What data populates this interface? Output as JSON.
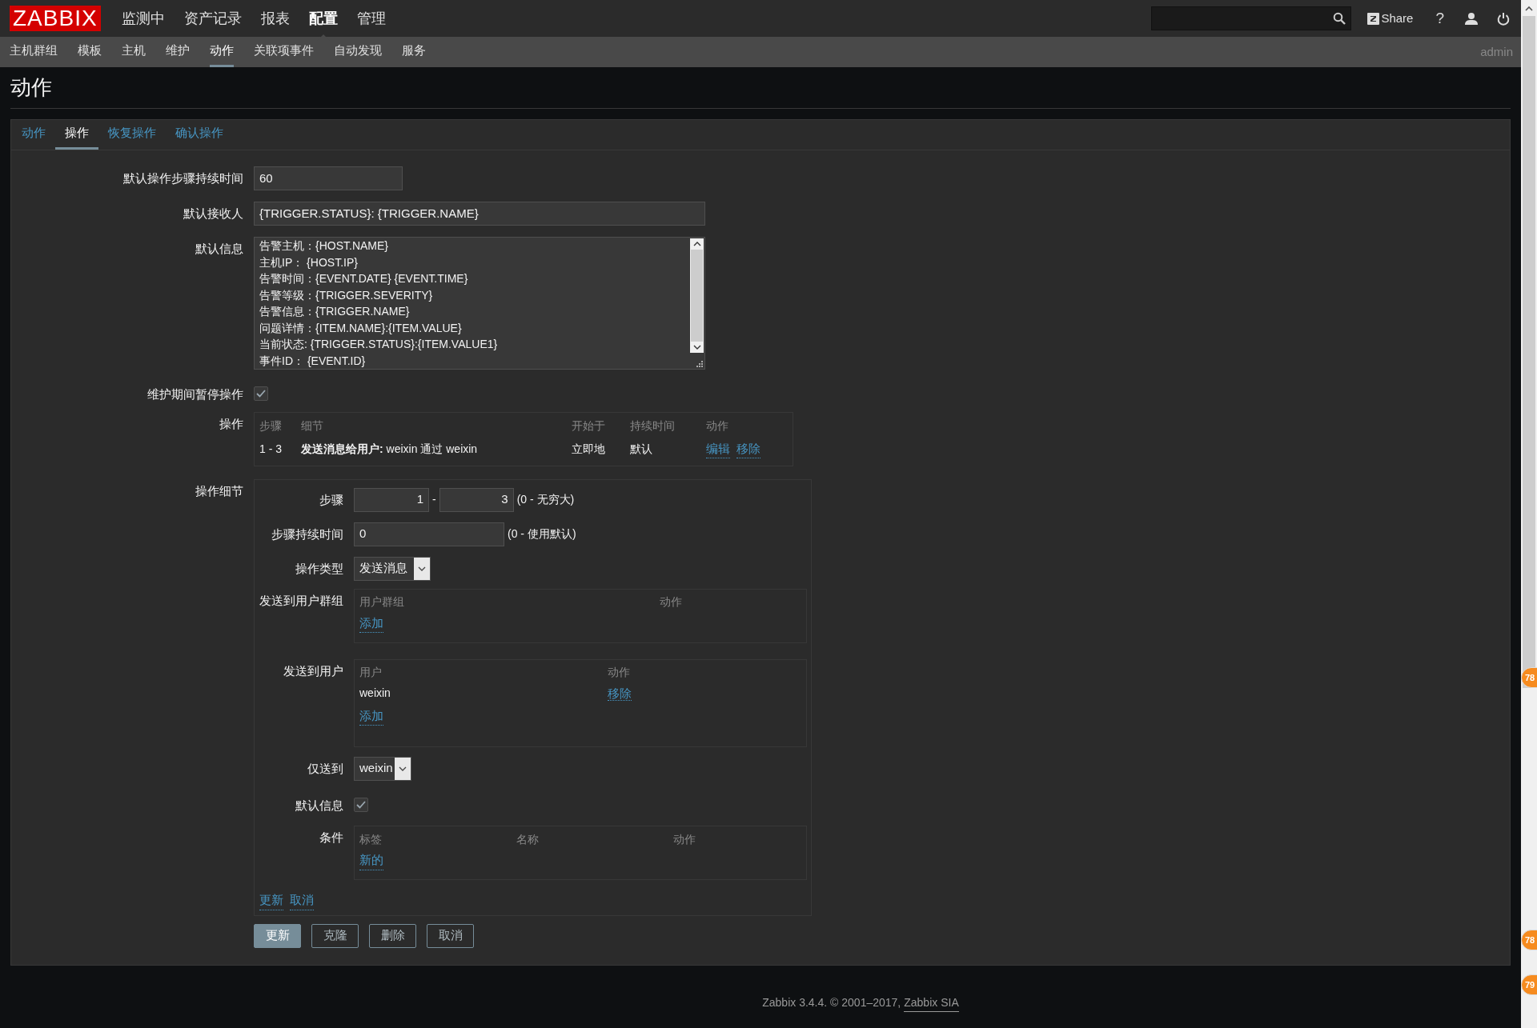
{
  "header": {
    "logo": "ZABBIX",
    "menu": [
      {
        "label": "监测中",
        "selected": false
      },
      {
        "label": "资产记录",
        "selected": false
      },
      {
        "label": "报表",
        "selected": false
      },
      {
        "label": "配置",
        "selected": true
      },
      {
        "label": "管理",
        "selected": false
      }
    ],
    "share": "Share",
    "help": "?"
  },
  "subnav": {
    "items": [
      {
        "label": "主机群组",
        "selected": false
      },
      {
        "label": "模板",
        "selected": false
      },
      {
        "label": "主机",
        "selected": false
      },
      {
        "label": "维护",
        "selected": false
      },
      {
        "label": "动作",
        "selected": true
      },
      {
        "label": "关联项事件",
        "selected": false
      },
      {
        "label": "自动发现",
        "selected": false
      },
      {
        "label": "服务",
        "selected": false
      }
    ],
    "user": "admin"
  },
  "page_title": "动作",
  "tabs": [
    {
      "label": "动作",
      "selected": false
    },
    {
      "label": "操作",
      "selected": true
    },
    {
      "label": "恢复操作",
      "selected": false
    },
    {
      "label": "确认操作",
      "selected": false
    }
  ],
  "form": {
    "default_step_duration": {
      "label": "默认操作步骤持续时间",
      "value": "60"
    },
    "default_subject": {
      "label": "默认接收人",
      "value": "{TRIGGER.STATUS}: {TRIGGER.NAME}"
    },
    "default_message": {
      "label": "默认信息",
      "lines": [
        "告警主机：{HOST.NAME}",
        "主机IP： {HOST.IP}",
        "告警时间：{EVENT.DATE} {EVENT.TIME}",
        "告警等级：{TRIGGER.SEVERITY}",
        "告警信息：{TRIGGER.NAME}",
        "问题详情：{ITEM.NAME}:{ITEM.VALUE}",
        "当前状态: {TRIGGER.STATUS}:{ITEM.VALUE1}",
        "事件ID： {EVENT.ID}"
      ]
    },
    "pause_in_maintenance": {
      "label": "维护期间暂停操作",
      "checked": true
    },
    "operations": {
      "label": "操作",
      "columns": [
        "步骤",
        "细节",
        "开始于",
        "持续时间",
        "动作"
      ],
      "rows": [
        {
          "steps": "1 - 3",
          "details": "**发送消息给用户:** weixin 通过 weixin",
          "start_in": "立即地",
          "duration": "默认",
          "actions": [
            "编辑",
            "移除"
          ]
        }
      ]
    },
    "operation_details": {
      "label": "操作细节",
      "steps": {
        "label": "步骤",
        "from": "1",
        "separator": "-",
        "to": "3",
        "hint": "(0 - 无穷大)"
      },
      "step_duration": {
        "label": "步骤持续时间",
        "value": "0",
        "hint": "(0 - 使用默认)"
      },
      "operation_type": {
        "label": "操作类型",
        "value": "发送消息"
      },
      "user_groups": {
        "label": "发送到用户群组",
        "columns": [
          "用户群组",
          "动作"
        ],
        "add_link": "添加"
      },
      "users": {
        "label": "发送到用户",
        "columns": [
          "用户",
          "动作"
        ],
        "rows": [
          {
            "user": "weixin",
            "action": "移除"
          }
        ],
        "add_link": "添加"
      },
      "send_only_to": {
        "label": "仅送到",
        "value": "weixin"
      },
      "default_message": {
        "label": "默认信息",
        "checked": true
      },
      "conditions": {
        "label": "条件",
        "columns": [
          "标签",
          "名称",
          "动作"
        ],
        "new_link": "新的"
      },
      "links": [
        "更新",
        "取消"
      ]
    },
    "buttons": [
      {
        "label": "更新",
        "kind": "primary"
      },
      {
        "label": "克隆",
        "kind": "secondary"
      },
      {
        "label": "删除",
        "kind": "secondary"
      },
      {
        "label": "取消",
        "kind": "secondary"
      }
    ]
  },
  "footer": {
    "text": "Zabbix 3.4.4. © 2001–2017,",
    "link": "Zabbix SIA"
  },
  "side_badges": [
    "78",
    "78",
    "79"
  ]
}
